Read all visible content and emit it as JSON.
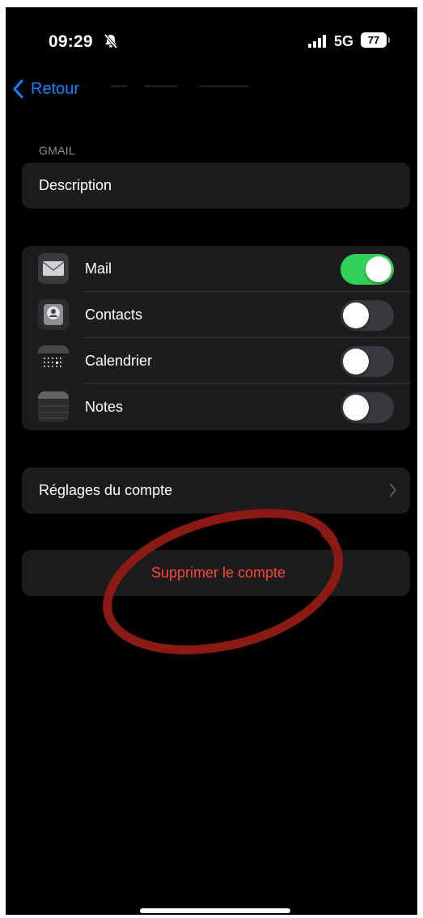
{
  "status_bar": {
    "time": "09:29",
    "network": "5G",
    "battery": "77"
  },
  "nav": {
    "back_label": "Retour"
  },
  "section": {
    "header": "GMAIL",
    "description_label": "Description"
  },
  "services": [
    {
      "label": "Mail",
      "icon": "mail-icon",
      "enabled": true
    },
    {
      "label": "Contacts",
      "icon": "contacts-icon",
      "enabled": false
    },
    {
      "label": "Calendrier",
      "icon": "calendar-icon",
      "enabled": false
    },
    {
      "label": "Notes",
      "icon": "notes-icon",
      "enabled": false
    }
  ],
  "account_settings_label": "Réglages du compte",
  "delete_label": "Supprimer le compte",
  "colors": {
    "accent_blue": "#0a84ff",
    "toggle_on": "#30d158",
    "destructive": "#ff453a",
    "annotation": "#8b1a14"
  }
}
